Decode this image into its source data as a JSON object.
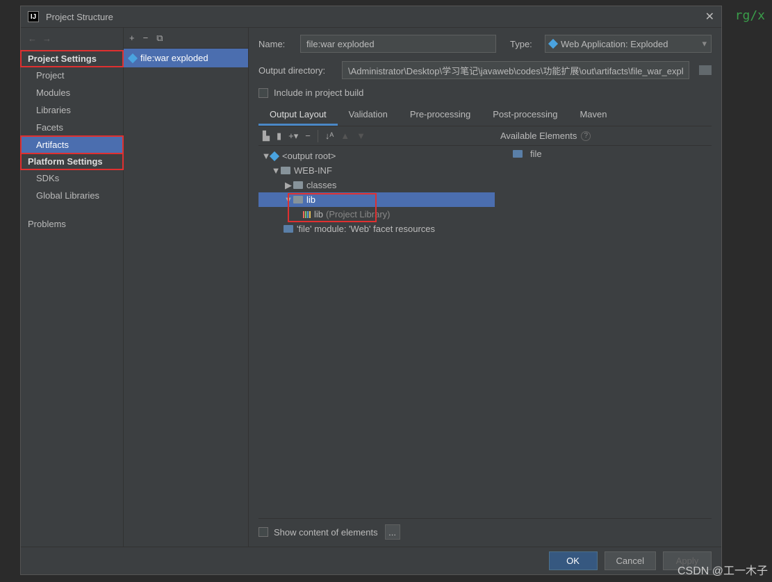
{
  "bg_text": "rg/x",
  "window": {
    "title": "Project Structure"
  },
  "sidebar": {
    "section1": "Project Settings",
    "items1": [
      "Project",
      "Modules",
      "Libraries",
      "Facets",
      "Artifacts"
    ],
    "section2": "Platform Settings",
    "items2": [
      "SDKs",
      "Global Libraries"
    ],
    "problems": "Problems"
  },
  "mid": {
    "artifact": "file:war exploded"
  },
  "form": {
    "name_label": "Name:",
    "name_value": "file:war exploded",
    "type_label": "Type:",
    "type_value": "Web Application: Exploded",
    "outdir_label": "Output directory:",
    "outdir_value": "\\Administrator\\Desktop\\学习笔记\\javaweb\\codes\\功能扩展\\out\\artifacts\\file_war_exploded",
    "include_label": "Include in project build"
  },
  "tabs": [
    "Output Layout",
    "Validation",
    "Pre-processing",
    "Post-processing",
    "Maven"
  ],
  "tree": {
    "root": "<output root>",
    "webinf": "WEB-INF",
    "classes": "classes",
    "lib": "lib",
    "lib_entry": "lib",
    "lib_entry_suffix": "(Project Library)",
    "facet": "'file' module: 'Web' facet resources"
  },
  "avail": {
    "header": "Available Elements",
    "item": "file"
  },
  "bottom": {
    "show_content": "Show content of elements",
    "dots": "..."
  },
  "footer": {
    "ok": "OK",
    "cancel": "Cancel",
    "apply": "Apply"
  },
  "watermark": "CSDN @工一木子"
}
